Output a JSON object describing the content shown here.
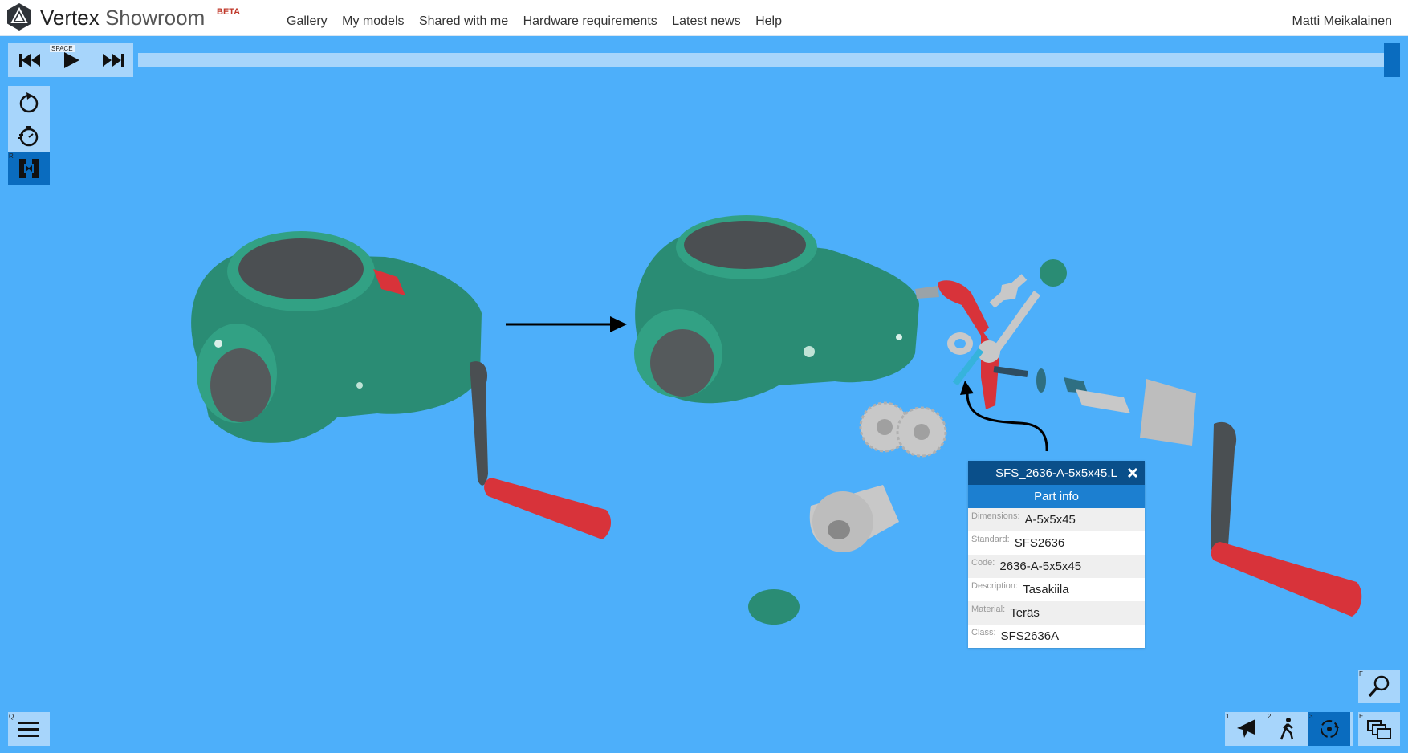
{
  "app": {
    "brand_primary": "Vertex",
    "brand_secondary": "Showroom",
    "badge": "BETA"
  },
  "nav": [
    "Gallery",
    "My models",
    "Shared with me",
    "Hardware requirements",
    "Latest news",
    "Help"
  ],
  "user": "Matti Meikalainen",
  "playback": {
    "space_key": "SPACE",
    "progress": 1.0
  },
  "left_tools": {
    "key_hint": "R"
  },
  "bottom": {
    "menu_key": "Q",
    "search_key": "F",
    "mode_keys": [
      "1",
      "2",
      "3"
    ],
    "views_key": "E"
  },
  "part_panel": {
    "title": "SFS_2636-A-5x5x45.L",
    "section": "Part info",
    "rows": [
      {
        "label": "Dimensions:",
        "value": "A-5x5x45"
      },
      {
        "label": "Standard:",
        "value": "SFS2636"
      },
      {
        "label": "Code:",
        "value": "2636-A-5x5x45"
      },
      {
        "label": "Description:",
        "value": "Tasakiila"
      },
      {
        "label": "Material:",
        "value": "Teräs"
      },
      {
        "label": "Class:",
        "value": "SFS2636A"
      }
    ]
  },
  "colors": {
    "viewport": "#4daffa",
    "accent": "#0a6cbf",
    "housing": "#2a8c74",
    "handle": "#d8333a",
    "metal": "#c8c8c8"
  }
}
